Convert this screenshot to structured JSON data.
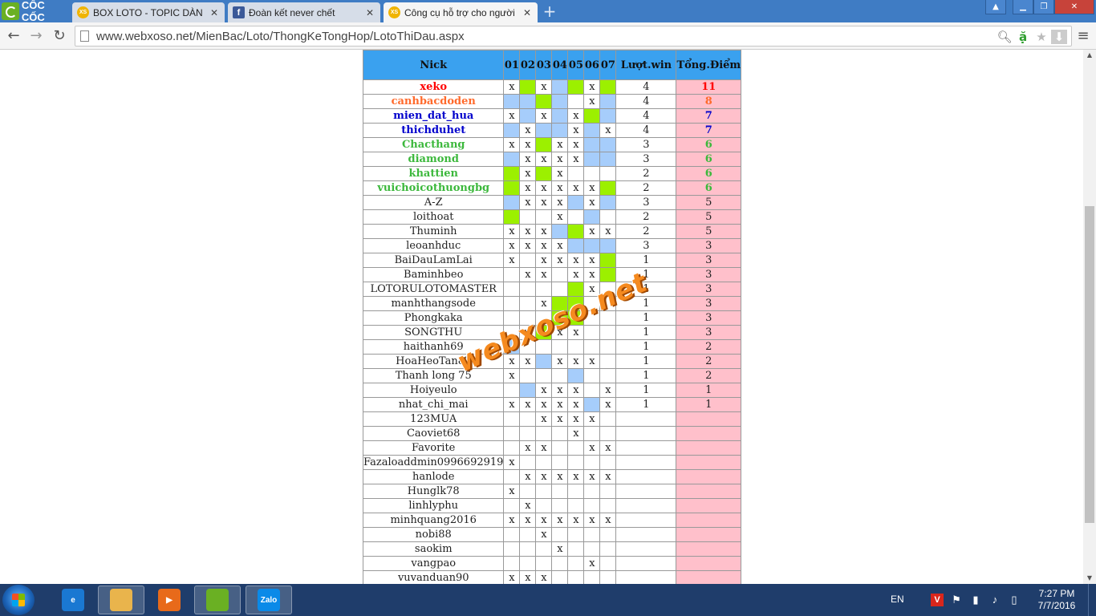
{
  "browser": {
    "logo_text": "CỐC CỐC",
    "tabs": [
      {
        "title": "BOX LOTO - TOPIC DÀN L",
        "favicon": "XS",
        "active": false
      },
      {
        "title": "Đoàn kết never chết",
        "favicon": "f",
        "active": false
      },
      {
        "title": "Công cụ hỗ trợ cho người",
        "favicon": "XS",
        "active": true
      }
    ],
    "url": "www.webxoso.net/MienBac/Loto/ThongKeTongHop/LotoThiDau.aspx"
  },
  "table": {
    "headers": [
      "Nick",
      "01",
      "02",
      "03",
      "04",
      "05",
      "06",
      "07",
      "Lượt.win",
      "Tổng.Điểm"
    ],
    "rows": [
      {
        "nick": "xeko",
        "color": "#ff0000",
        "cells": [
          "x",
          "g",
          "x",
          "b",
          "g",
          "x",
          "g"
        ],
        "win": "4",
        "points": "11",
        "pcolor": "#ff0000"
      },
      {
        "nick": "canhbacdoden",
        "color": "#ff6a2b",
        "cells": [
          "b",
          "b",
          "g",
          "b",
          "",
          "x",
          "b"
        ],
        "win": "4",
        "points": "8",
        "pcolor": "#ff6a2b"
      },
      {
        "nick": "mien_dat_hua",
        "color": "#0000cc",
        "cells": [
          "x",
          "b",
          "x",
          "b",
          "x",
          "g",
          "b"
        ],
        "win": "4",
        "points": "7",
        "pcolor": "#0000cc"
      },
      {
        "nick": "thichduhet",
        "color": "#0000cc",
        "cells": [
          "b",
          "x",
          "b",
          "b",
          "x",
          "b",
          "x"
        ],
        "win": "4",
        "points": "7",
        "pcolor": "#0000cc"
      },
      {
        "nick": "Chacthang",
        "color": "#3cb83c",
        "cells": [
          "x",
          "x",
          "g",
          "x",
          "x",
          "b",
          "b"
        ],
        "win": "3",
        "points": "6",
        "pcolor": "#3cb83c"
      },
      {
        "nick": "diamond",
        "color": "#3cb83c",
        "cells": [
          "b",
          "x",
          "x",
          "x",
          "x",
          "b",
          "b"
        ],
        "win": "3",
        "points": "6",
        "pcolor": "#3cb83c"
      },
      {
        "nick": "khattien",
        "color": "#3cb83c",
        "cells": [
          "g",
          "x",
          "g",
          "x",
          "",
          "",
          ""
        ],
        "win": "2",
        "points": "6",
        "pcolor": "#3cb83c"
      },
      {
        "nick": "vuichoicothuongbg",
        "color": "#3cb83c",
        "cells": [
          "g",
          "x",
          "x",
          "x",
          "x",
          "x",
          "g"
        ],
        "win": "2",
        "points": "6",
        "pcolor": "#3cb83c"
      },
      {
        "nick": "A-Z",
        "color": "",
        "cells": [
          "b",
          "x",
          "x",
          "x",
          "b",
          "x",
          "b"
        ],
        "win": "3",
        "points": "5",
        "pcolor": ""
      },
      {
        "nick": "loithoat",
        "color": "",
        "cells": [
          "g",
          "",
          "",
          "x",
          "",
          "b",
          ""
        ],
        "win": "2",
        "points": "5",
        "pcolor": ""
      },
      {
        "nick": "Thuminh",
        "color": "",
        "cells": [
          "x",
          "x",
          "x",
          "b",
          "g",
          "x",
          "x"
        ],
        "win": "2",
        "points": "5",
        "pcolor": ""
      },
      {
        "nick": "leoanhduc",
        "color": "",
        "cells": [
          "x",
          "x",
          "x",
          "x",
          "b",
          "b",
          "b"
        ],
        "win": "3",
        "points": "3",
        "pcolor": ""
      },
      {
        "nick": "BaiDauLamLai",
        "color": "",
        "cells": [
          "x",
          "",
          "x",
          "x",
          "x",
          "x",
          "g"
        ],
        "win": "1",
        "points": "3",
        "pcolor": ""
      },
      {
        "nick": "Baminhbeo",
        "color": "",
        "cells": [
          "",
          "x",
          "x",
          "",
          "x",
          "x",
          "g"
        ],
        "win": "1",
        "points": "3",
        "pcolor": ""
      },
      {
        "nick": "LOTORULOTOMASTER",
        "color": "",
        "cells": [
          "",
          "",
          "",
          "",
          "g",
          "x",
          ""
        ],
        "win": "1",
        "points": "3",
        "pcolor": ""
      },
      {
        "nick": "manhthangsode",
        "color": "",
        "cells": [
          "",
          "",
          "x",
          "g",
          "g",
          "",
          ""
        ],
        "win": "1",
        "points": "3",
        "pcolor": ""
      },
      {
        "nick": "Phongkaka",
        "color": "",
        "cells": [
          "",
          "",
          "",
          "g",
          "g",
          "",
          ""
        ],
        "win": "1",
        "points": "3",
        "pcolor": ""
      },
      {
        "nick": "SONGTHU",
        "color": "",
        "cells": [
          "",
          "x",
          "g",
          "x",
          "x",
          "",
          ""
        ],
        "win": "1",
        "points": "3",
        "pcolor": ""
      },
      {
        "nick": "haithanh69",
        "color": "",
        "cells": [
          "b",
          "",
          "",
          "",
          "",
          "",
          ""
        ],
        "win": "1",
        "points": "2",
        "pcolor": ""
      },
      {
        "nick": "HoaHeoTan87",
        "color": "",
        "cells": [
          "x",
          "x",
          "b",
          "x",
          "x",
          "x",
          ""
        ],
        "win": "1",
        "points": "2",
        "pcolor": ""
      },
      {
        "nick": "Thanh long 75",
        "color": "",
        "cells": [
          "x",
          "",
          "",
          "",
          "b",
          "",
          ""
        ],
        "win": "1",
        "points": "2",
        "pcolor": ""
      },
      {
        "nick": "Hoiyeulo",
        "color": "",
        "cells": [
          "",
          "b",
          "x",
          "x",
          "x",
          "",
          "x"
        ],
        "win": "1",
        "points": "1",
        "pcolor": ""
      },
      {
        "nick": "nhat_chi_mai",
        "color": "",
        "cells": [
          "x",
          "x",
          "x",
          "x",
          "x",
          "b",
          "x"
        ],
        "win": "1",
        "points": "1",
        "pcolor": ""
      },
      {
        "nick": "123MUA",
        "color": "",
        "cells": [
          "",
          "",
          "x",
          "x",
          "x",
          "x",
          ""
        ],
        "win": "",
        "points": "",
        "pcolor": ""
      },
      {
        "nick": "Caoviet68",
        "color": "",
        "cells": [
          "",
          "",
          "",
          "",
          "x",
          "",
          ""
        ],
        "win": "",
        "points": "",
        "pcolor": ""
      },
      {
        "nick": "Favorite",
        "color": "",
        "cells": [
          "",
          "x",
          "x",
          "",
          "",
          "x",
          "x"
        ],
        "win": "",
        "points": "",
        "pcolor": ""
      },
      {
        "nick": "Fazaloaddmin0996692919",
        "color": "",
        "cells": [
          "x",
          "",
          "",
          "",
          "",
          "",
          ""
        ],
        "win": "",
        "points": "",
        "pcolor": ""
      },
      {
        "nick": "hanlode",
        "color": "",
        "cells": [
          "",
          "x",
          "x",
          "x",
          "x",
          "x",
          "x"
        ],
        "win": "",
        "points": "",
        "pcolor": ""
      },
      {
        "nick": "Hunglk78",
        "color": "",
        "cells": [
          "x",
          "",
          "",
          "",
          "",
          "",
          ""
        ],
        "win": "",
        "points": "",
        "pcolor": ""
      },
      {
        "nick": "linhlyphu",
        "color": "",
        "cells": [
          "",
          "x",
          "",
          "",
          "",
          "",
          ""
        ],
        "win": "",
        "points": "",
        "pcolor": ""
      },
      {
        "nick": "minhquang2016",
        "color": "",
        "cells": [
          "x",
          "x",
          "x",
          "x",
          "x",
          "x",
          "x"
        ],
        "win": "",
        "points": "",
        "pcolor": ""
      },
      {
        "nick": "nobi88",
        "color": "",
        "cells": [
          "",
          "",
          "x",
          "",
          "",
          "",
          ""
        ],
        "win": "",
        "points": "",
        "pcolor": ""
      },
      {
        "nick": "saokim",
        "color": "",
        "cells": [
          "",
          "",
          "",
          "x",
          "",
          "",
          ""
        ],
        "win": "",
        "points": "",
        "pcolor": ""
      },
      {
        "nick": "vangpao",
        "color": "",
        "cells": [
          "",
          "",
          "",
          "",
          "",
          "x",
          ""
        ],
        "win": "",
        "points": "",
        "pcolor": ""
      },
      {
        "nick": "vuvanduan90",
        "color": "",
        "cells": [
          "x",
          "x",
          "x",
          "",
          "",
          "",
          ""
        ],
        "win": "",
        "points": "",
        "pcolor": ""
      }
    ]
  },
  "watermark": "webxoso.net",
  "taskbar": {
    "apps": [
      {
        "name": "ie-icon",
        "label": "e",
        "bg": "#1a78d2",
        "active": false
      },
      {
        "name": "file-explorer-icon",
        "label": "",
        "bg": "#e9b44c",
        "active": true
      },
      {
        "name": "media-player-icon",
        "label": "▶",
        "bg": "#e86a1a",
        "active": false
      },
      {
        "name": "coccoc-icon",
        "label": "",
        "bg": "#6ab023",
        "active": true
      },
      {
        "name": "zalo-icon",
        "label": "Zalo",
        "bg": "#0a8ae8",
        "active": true
      }
    ],
    "lang": "EN",
    "time": "7:27 PM",
    "date": "7/7/2016"
  }
}
